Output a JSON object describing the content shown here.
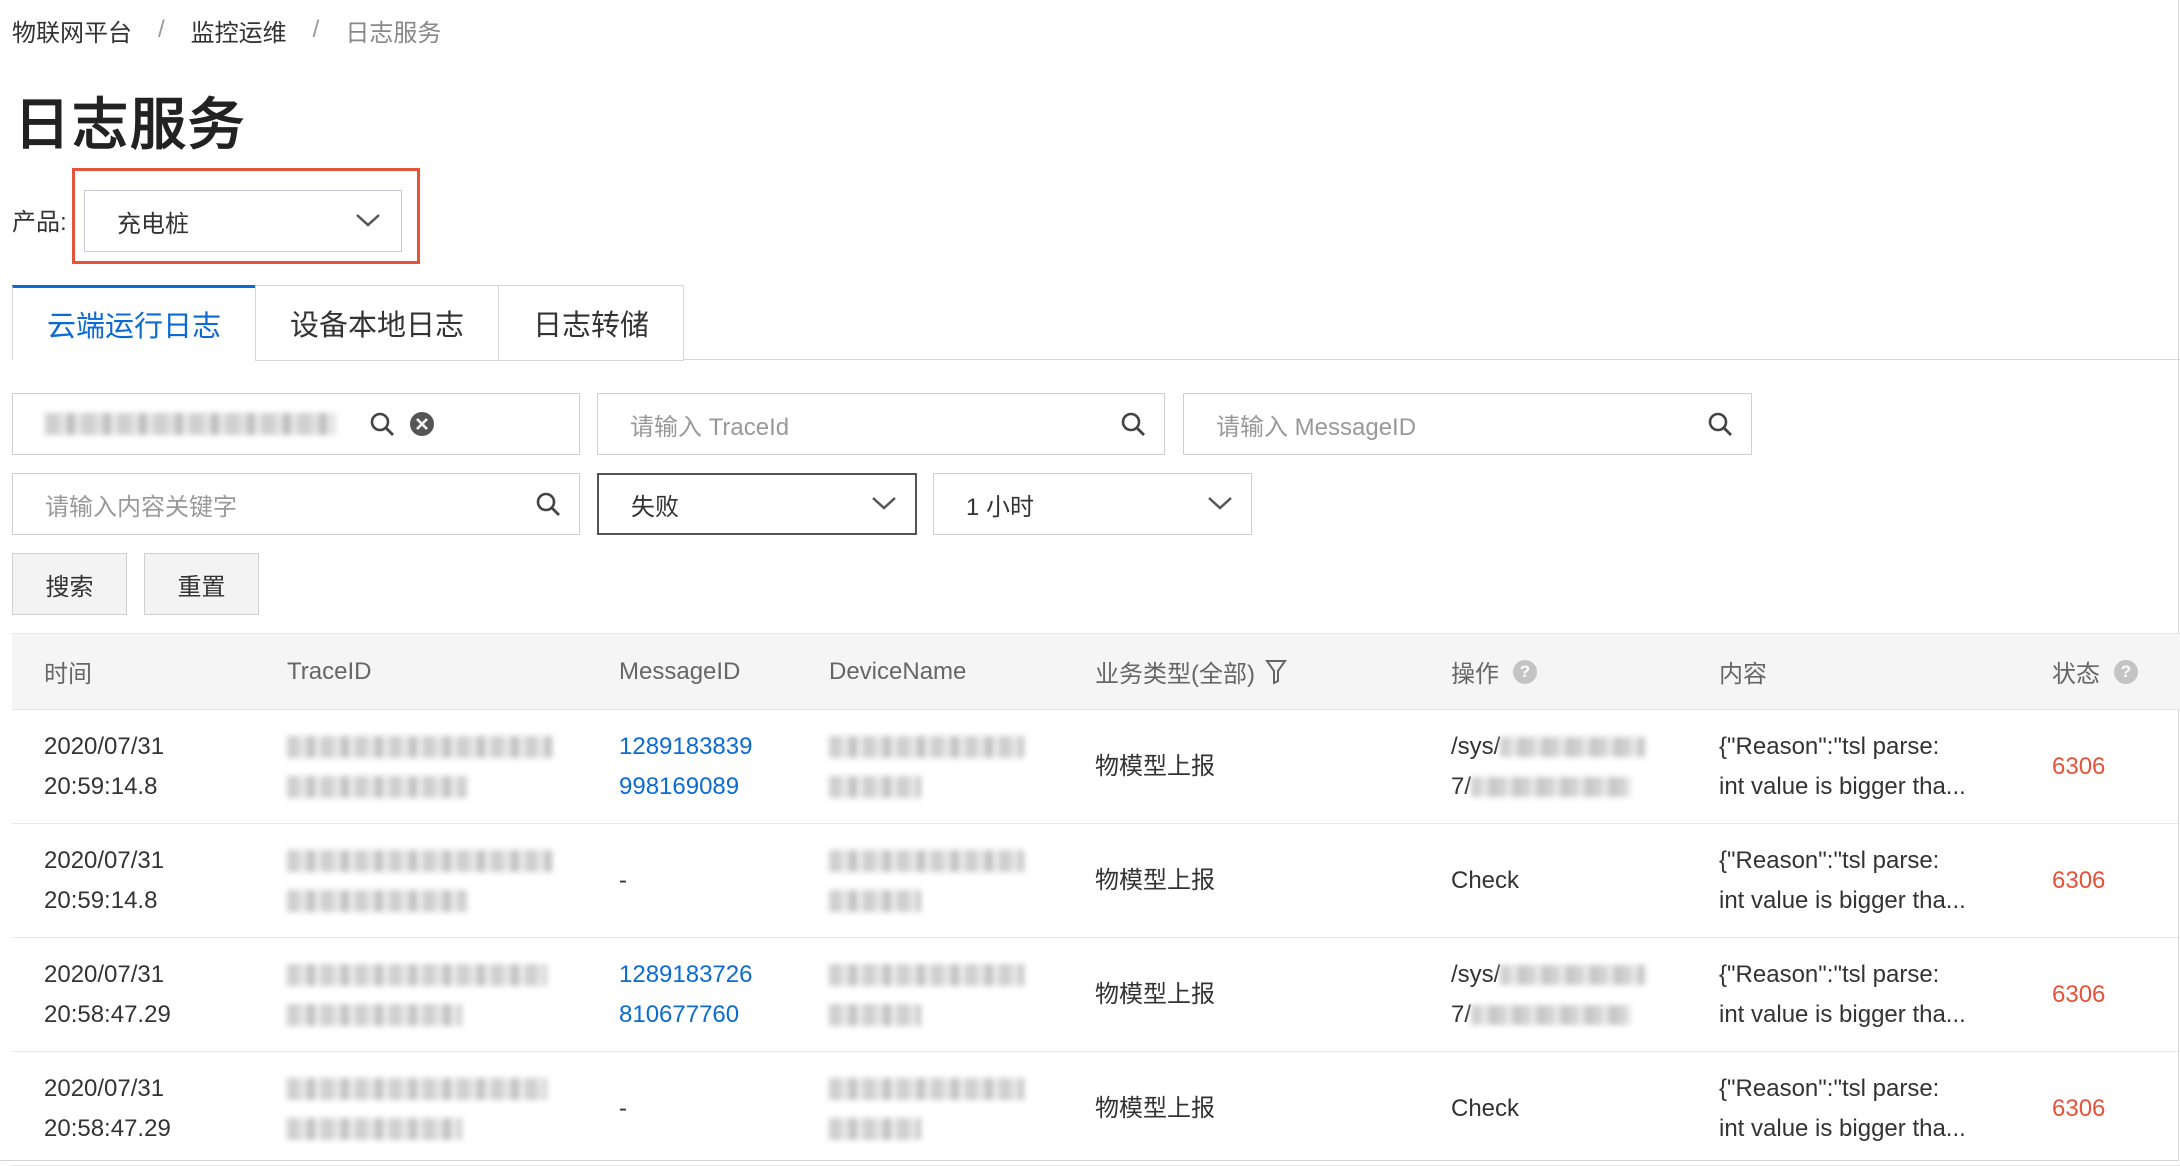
{
  "breadcrumb": [
    "物联网平台",
    "监控运维",
    "日志服务"
  ],
  "breadcrumb_separator": "/",
  "page_title": "日志服务",
  "product": {
    "label": "产品:",
    "value": "充电桩"
  },
  "tabs": [
    {
      "label": "云端运行日志",
      "active": true
    },
    {
      "label": "设备本地日志",
      "active": false
    },
    {
      "label": "日志转储",
      "active": false
    }
  ],
  "filters": {
    "device_search_value": "",
    "traceid_placeholder": "请输入 TraceId",
    "messageid_placeholder": "请输入 MessageID",
    "keyword_placeholder": "请输入内容关键字",
    "status_value": "失败",
    "time_value": "1 小时"
  },
  "buttons": {
    "search": "搜索",
    "reset": "重置"
  },
  "columns": [
    "时间",
    "TraceID",
    "MessageID",
    "DeviceName",
    "业务类型(全部)",
    "操作",
    "内容",
    "状态"
  ],
  "rows": [
    {
      "time_date": "2020/07/31",
      "time_clock": "20:59:14.8",
      "message_id_1": "1289183839",
      "message_id_2": "998169089",
      "business_type": "物模型上报",
      "op_1": "/sys/",
      "op_2": "7/",
      "content_1": "{\"Reason\":\"tsl parse:",
      "content_2": "int value is bigger tha...",
      "status": "6306"
    },
    {
      "time_date": "2020/07/31",
      "time_clock": "20:59:14.8",
      "message_id_1": "-",
      "message_id_2": "",
      "business_type": "物模型上报",
      "op_1": "Check",
      "op_2": "",
      "content_1": "{\"Reason\":\"tsl parse:",
      "content_2": "int value is bigger tha...",
      "status": "6306"
    },
    {
      "time_date": "2020/07/31",
      "time_clock": "20:58:47.29",
      "message_id_1": "1289183726",
      "message_id_2": "810677760",
      "business_type": "物模型上报",
      "op_1": "/sys/",
      "op_2": "7/",
      "content_1": "{\"Reason\":\"tsl parse:",
      "content_2": "int value is bigger tha...",
      "status": "6306"
    },
    {
      "time_date": "2020/07/31",
      "time_clock": "20:58:47.29",
      "message_id_1": "-",
      "message_id_2": "",
      "business_type": "物模型上报",
      "op_1": "Check",
      "op_2": "",
      "content_1": "{\"Reason\":\"tsl parse:",
      "content_2": "int value is bigger tha...",
      "status": "6306"
    }
  ],
  "colors": {
    "accent": "#0b6bd3",
    "error": "#e4533a",
    "highlight": "#e4533a"
  }
}
